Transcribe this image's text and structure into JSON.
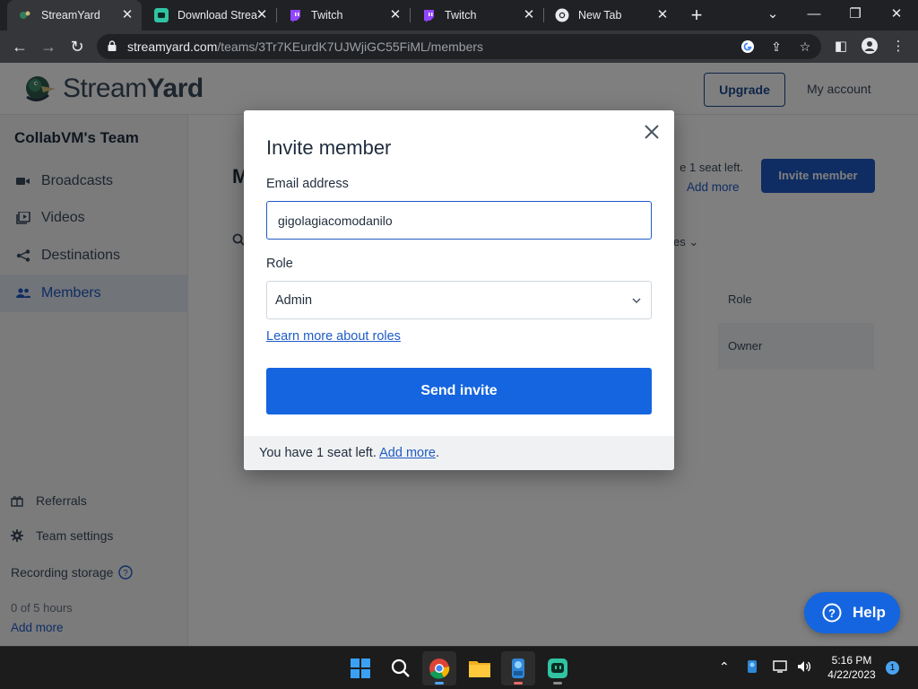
{
  "browser": {
    "tabs": [
      {
        "title": "StreamYard",
        "active": true
      },
      {
        "title": "Download Strea",
        "active": false
      },
      {
        "title": "Twitch",
        "active": false
      },
      {
        "title": "Twitch",
        "active": false
      },
      {
        "title": "New Tab",
        "active": false
      }
    ],
    "url_host": "streamyard.com",
    "url_path": "/teams/3Tr7KEurdK7UJWjiGC55FiML/members"
  },
  "header": {
    "logo_text_a": "Stream",
    "logo_text_b": "Yard",
    "upgrade_label": "Upgrade",
    "my_account_label": "My account"
  },
  "sidebar": {
    "team_name": "CollabVM's Team",
    "items": [
      {
        "label": "Broadcasts",
        "icon": "camera-icon"
      },
      {
        "label": "Videos",
        "icon": "video-library-icon"
      },
      {
        "label": "Destinations",
        "icon": "share-icon"
      },
      {
        "label": "Members",
        "icon": "people-icon"
      }
    ],
    "referrals_label": "Referrals",
    "team_settings_label": "Team settings",
    "recording_storage_label": "Recording storage",
    "storage_usage": "0 of 5 hours",
    "add_more_label": "Add more"
  },
  "main": {
    "title_fragment": "M",
    "seats_text_fragment": "e 1 seat left.",
    "seats_add_more": "Add more",
    "invite_button_label": "Invite member",
    "roles_filter_fragment": "es",
    "role_column_header": "Role",
    "owner_role_value": "Owner"
  },
  "modal": {
    "title": "Invite member",
    "email_label": "Email address",
    "email_value": "gigolagiacomodanilo",
    "role_label": "Role",
    "role_value": "Admin",
    "learn_more_link": "Learn more about roles",
    "send_button_label": "Send invite",
    "footer_text": "You have 1 seat left. ",
    "footer_link": "Add more",
    "footer_period": "."
  },
  "help": {
    "label": "Help"
  },
  "taskbar": {
    "time": "5:16 PM",
    "date": "4/22/2023",
    "notification_count": "1"
  },
  "colors": {
    "brand_blue": "#1565e0",
    "link_blue": "#1f5bc5",
    "overlay": "rgba(0,0,0,0.5)"
  }
}
